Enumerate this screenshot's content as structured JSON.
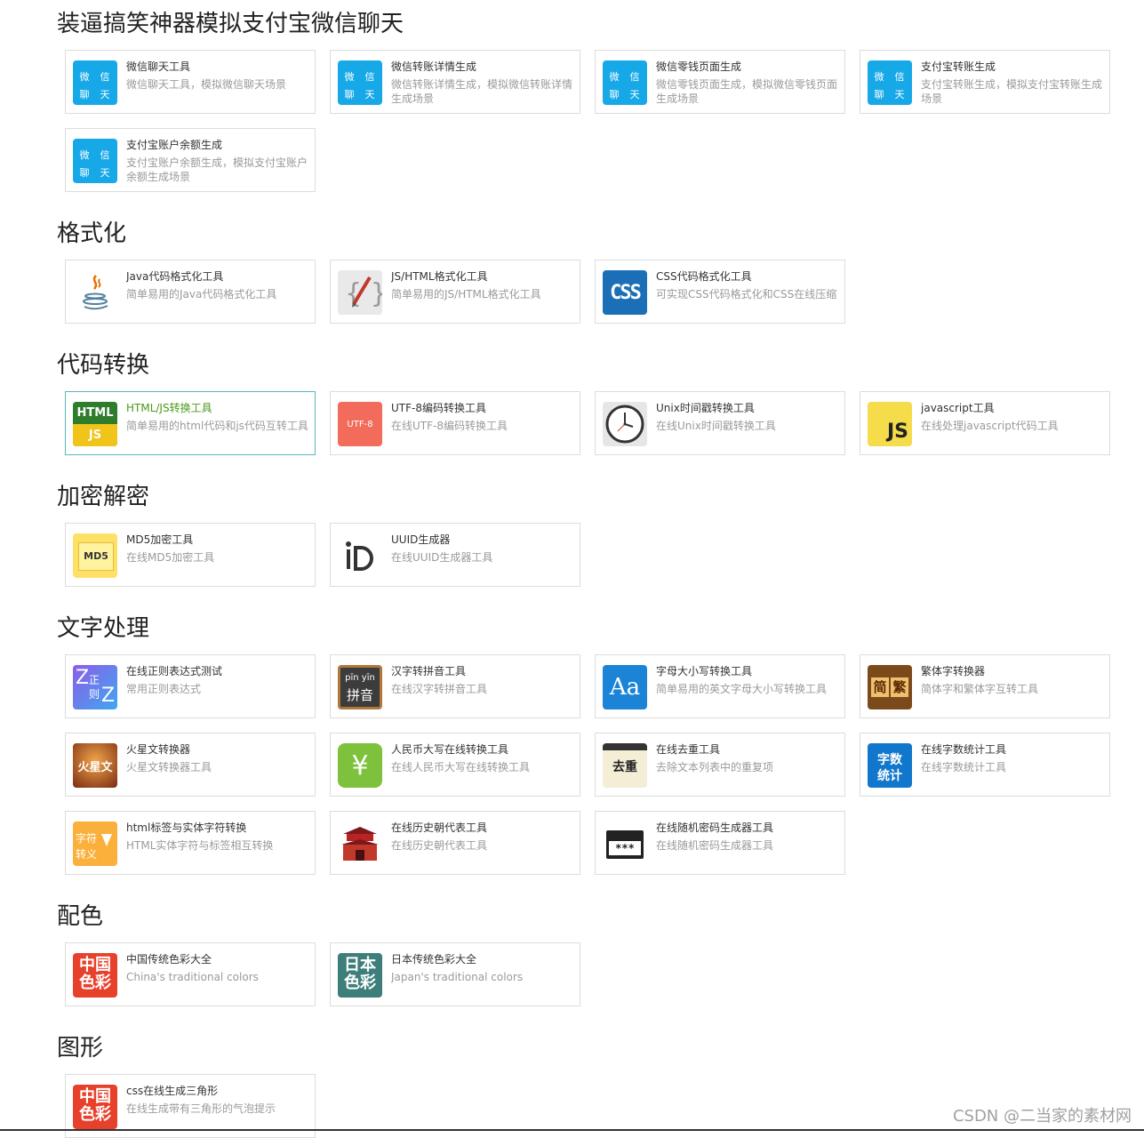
{
  "sections": [
    {
      "title": "装逼搞笑神器模拟支付宝微信聊天",
      "tools": [
        {
          "title": "微信聊天工具",
          "desc": "微信聊天工具，模拟微信聊天场景",
          "icon": "wechat-chat-icon"
        },
        {
          "title": "微信转账详情生成",
          "desc": "微信转账详情生成，模拟微信转账详情生成场景",
          "icon": "wechat-chat-icon"
        },
        {
          "title": "微信零钱页面生成",
          "desc": "微信零钱页面生成，模拟微信零钱页面生成场景",
          "icon": "wechat-chat-icon"
        },
        {
          "title": "支付宝转账生成",
          "desc": "支付宝转账生成，模拟支付宝转账生成场景",
          "icon": "wechat-chat-icon"
        },
        {
          "title": "支付宝账户余额生成",
          "desc": "支付宝账户余额生成，模拟支付宝账户余额生成场景",
          "icon": "wechat-chat-icon"
        }
      ]
    },
    {
      "title": "格式化",
      "tools": [
        {
          "title": "Java代码格式化工具",
          "desc": "简单易用的Java代码格式化工具",
          "icon": "java-icon"
        },
        {
          "title": "JS/HTML格式化工具",
          "desc": "简单易用的JS/HTML格式化工具",
          "icon": "braces-pencil-icon"
        },
        {
          "title": "CSS代码格式化工具",
          "desc": "可实现CSS代码格式化和CSS在线压缩",
          "icon": "css-icon"
        }
      ]
    },
    {
      "title": "代码转换",
      "tools": [
        {
          "title": "HTML/JS转换工具",
          "desc": "简单易用的html代码和js代码互转工具",
          "icon": "html-js-icon"
        },
        {
          "title": "UTF-8编码转换工具",
          "desc": "在线UTF-8编码转换工具",
          "icon": "utf8-icon"
        },
        {
          "title": "Unix时间戳转换工具",
          "desc": "在线Unix时间戳转换工具",
          "icon": "clock-icon"
        },
        {
          "title": "javascript工具",
          "desc": "在线处理javascript代码工具",
          "icon": "js-icon"
        }
      ]
    },
    {
      "title": "加密解密",
      "tools": [
        {
          "title": "MD5加密工具",
          "desc": "在线MD5加密工具",
          "icon": "md5-icon"
        },
        {
          "title": "UUID生成器",
          "desc": "在线UUID生成器工具",
          "icon": "uuid-icon"
        }
      ]
    },
    {
      "title": "文字处理",
      "tools": [
        {
          "title": "在线正则表达式测试",
          "desc": "常用正则表达式",
          "icon": "regex-icon"
        },
        {
          "title": "汉字转拼音工具",
          "desc": "在线汉字转拼音工具",
          "icon": "pinyin-icon"
        },
        {
          "title": "字母大小写转换工具",
          "desc": "简单易用的英文字母大小写转换工具",
          "icon": "letter-case-icon"
        },
        {
          "title": "繁体字转换器",
          "desc": "简体字和繁体字互转工具",
          "icon": "traditional-simplified-icon"
        },
        {
          "title": "火星文转换器",
          "desc": "火星文转换器工具",
          "icon": "martian-text-icon"
        },
        {
          "title": "人民币大写在线转换工具",
          "desc": "在线人民币大写在线转换工具",
          "icon": "rmb-icon"
        },
        {
          "title": "在线去重工具",
          "desc": "去除文本列表中的重复项",
          "icon": "dedupe-icon"
        },
        {
          "title": "在线字数统计工具",
          "desc": "在线字数统计工具",
          "icon": "word-count-icon"
        },
        {
          "title": "html标签与实体字符转换",
          "desc": "HTML实体字符与标签相互转换",
          "icon": "char-escape-icon"
        },
        {
          "title": "在线历史朝代表工具",
          "desc": "在线历史朝代表工具",
          "icon": "history-gate-icon"
        },
        {
          "title": "在线随机密码生成器工具",
          "desc": "在线随机密码生成器工具",
          "icon": "password-icon"
        }
      ]
    },
    {
      "title": "配色",
      "tools": [
        {
          "title": "中国传统色彩大全",
          "desc": "China's traditional colors",
          "icon": "china-colors-icon"
        },
        {
          "title": "日本传统色彩大全",
          "desc": "Japan's traditional colors",
          "icon": "japan-colors-icon"
        }
      ]
    },
    {
      "title": "图形",
      "tools": [
        {
          "title": "css在线生成三角形",
          "desc": "在线生成带有三角形的气泡提示",
          "icon": "china-colors-icon"
        }
      ]
    }
  ],
  "icon_text": {
    "wechat": [
      "微",
      "信",
      "聊",
      "天"
    ],
    "css": "CSS",
    "html": "HTML",
    "js": "JS",
    "utf8": "UTF-8",
    "md5": "MD5",
    "regex": [
      "Z",
      "正",
      "则",
      "Z"
    ],
    "pinyin_top": "pīn yīn",
    "pinyin_bottom": "拼音",
    "aa": "Aa",
    "jian": "简",
    "fan": "繁",
    "huoxing": "火星文",
    "rmb": "¥",
    "quchong": "去重",
    "zishu": [
      "字数",
      "统计"
    ],
    "zifu": [
      "字符",
      "转义"
    ],
    "password": "***",
    "cn_colors": [
      "中国",
      "色彩"
    ],
    "jp_colors": [
      "日本",
      "色彩"
    ]
  },
  "watermark": "CSDN @二当家的素材网",
  "colors": {
    "wechat_blue": "#17a8e8",
    "active_border": "#5bb9b9",
    "active_title": "#4a9a1a"
  }
}
